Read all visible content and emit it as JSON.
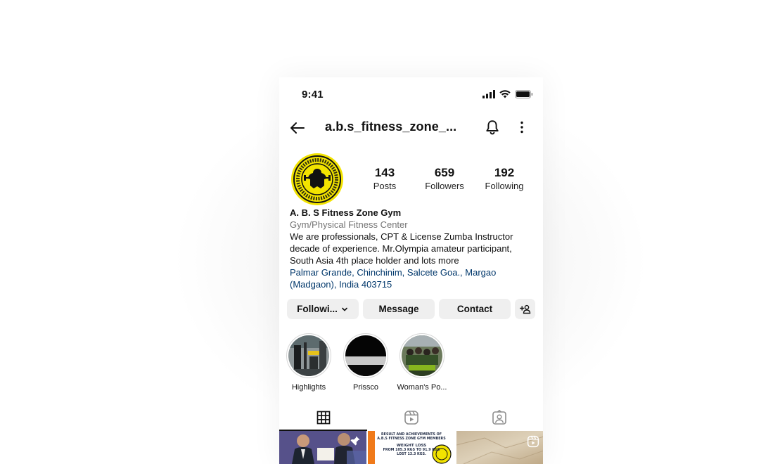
{
  "status_bar": {
    "time": "9:41"
  },
  "header": {
    "username": "a.b.s_fitness_zone_..."
  },
  "profile": {
    "stats": [
      {
        "value": "143",
        "label": "Posts"
      },
      {
        "value": "659",
        "label": "Followers"
      },
      {
        "value": "192",
        "label": "Following"
      }
    ],
    "name": "A. B. S Fitness Zone Gym",
    "category": "Gym/Physical Fitness Center",
    "bio_lines": [
      "We are professionals,  CPT & License Zumba Instructor",
      "decade of experience. Mr.Olympia amateur participant,",
      "South Asia 4th place holder and lots more"
    ],
    "address_lines": [
      "Palmar Grande, Chinchinim, Salcete Goa., Margao",
      "(Madgaon), India 403715"
    ]
  },
  "actions": {
    "following": "Followi...",
    "message": "Message",
    "contact": "Contact"
  },
  "highlights": [
    {
      "label": "Highlights"
    },
    {
      "label": "Prissco"
    },
    {
      "label": "Woman's Po..."
    }
  ],
  "tabs": [
    "posts-grid",
    "reels",
    "tagged"
  ],
  "grid_tiles": [
    {
      "icon": "pin-icon"
    },
    {
      "caption_lines": [
        "RESULT AND ACHIEVEMENTS OF",
        "A.B.S FITNESS ZONE GYM MEMBERS",
        "WEIGHT LOSS",
        "FROM 105.3 KGS TO 91.9 KGS",
        "LOST 13.3 KGS."
      ]
    },
    {
      "icon": "reel-icon"
    }
  ],
  "colors": {
    "link": "#00376b",
    "button_bg": "#efefef",
    "avatar_bg": "#f2e300"
  }
}
